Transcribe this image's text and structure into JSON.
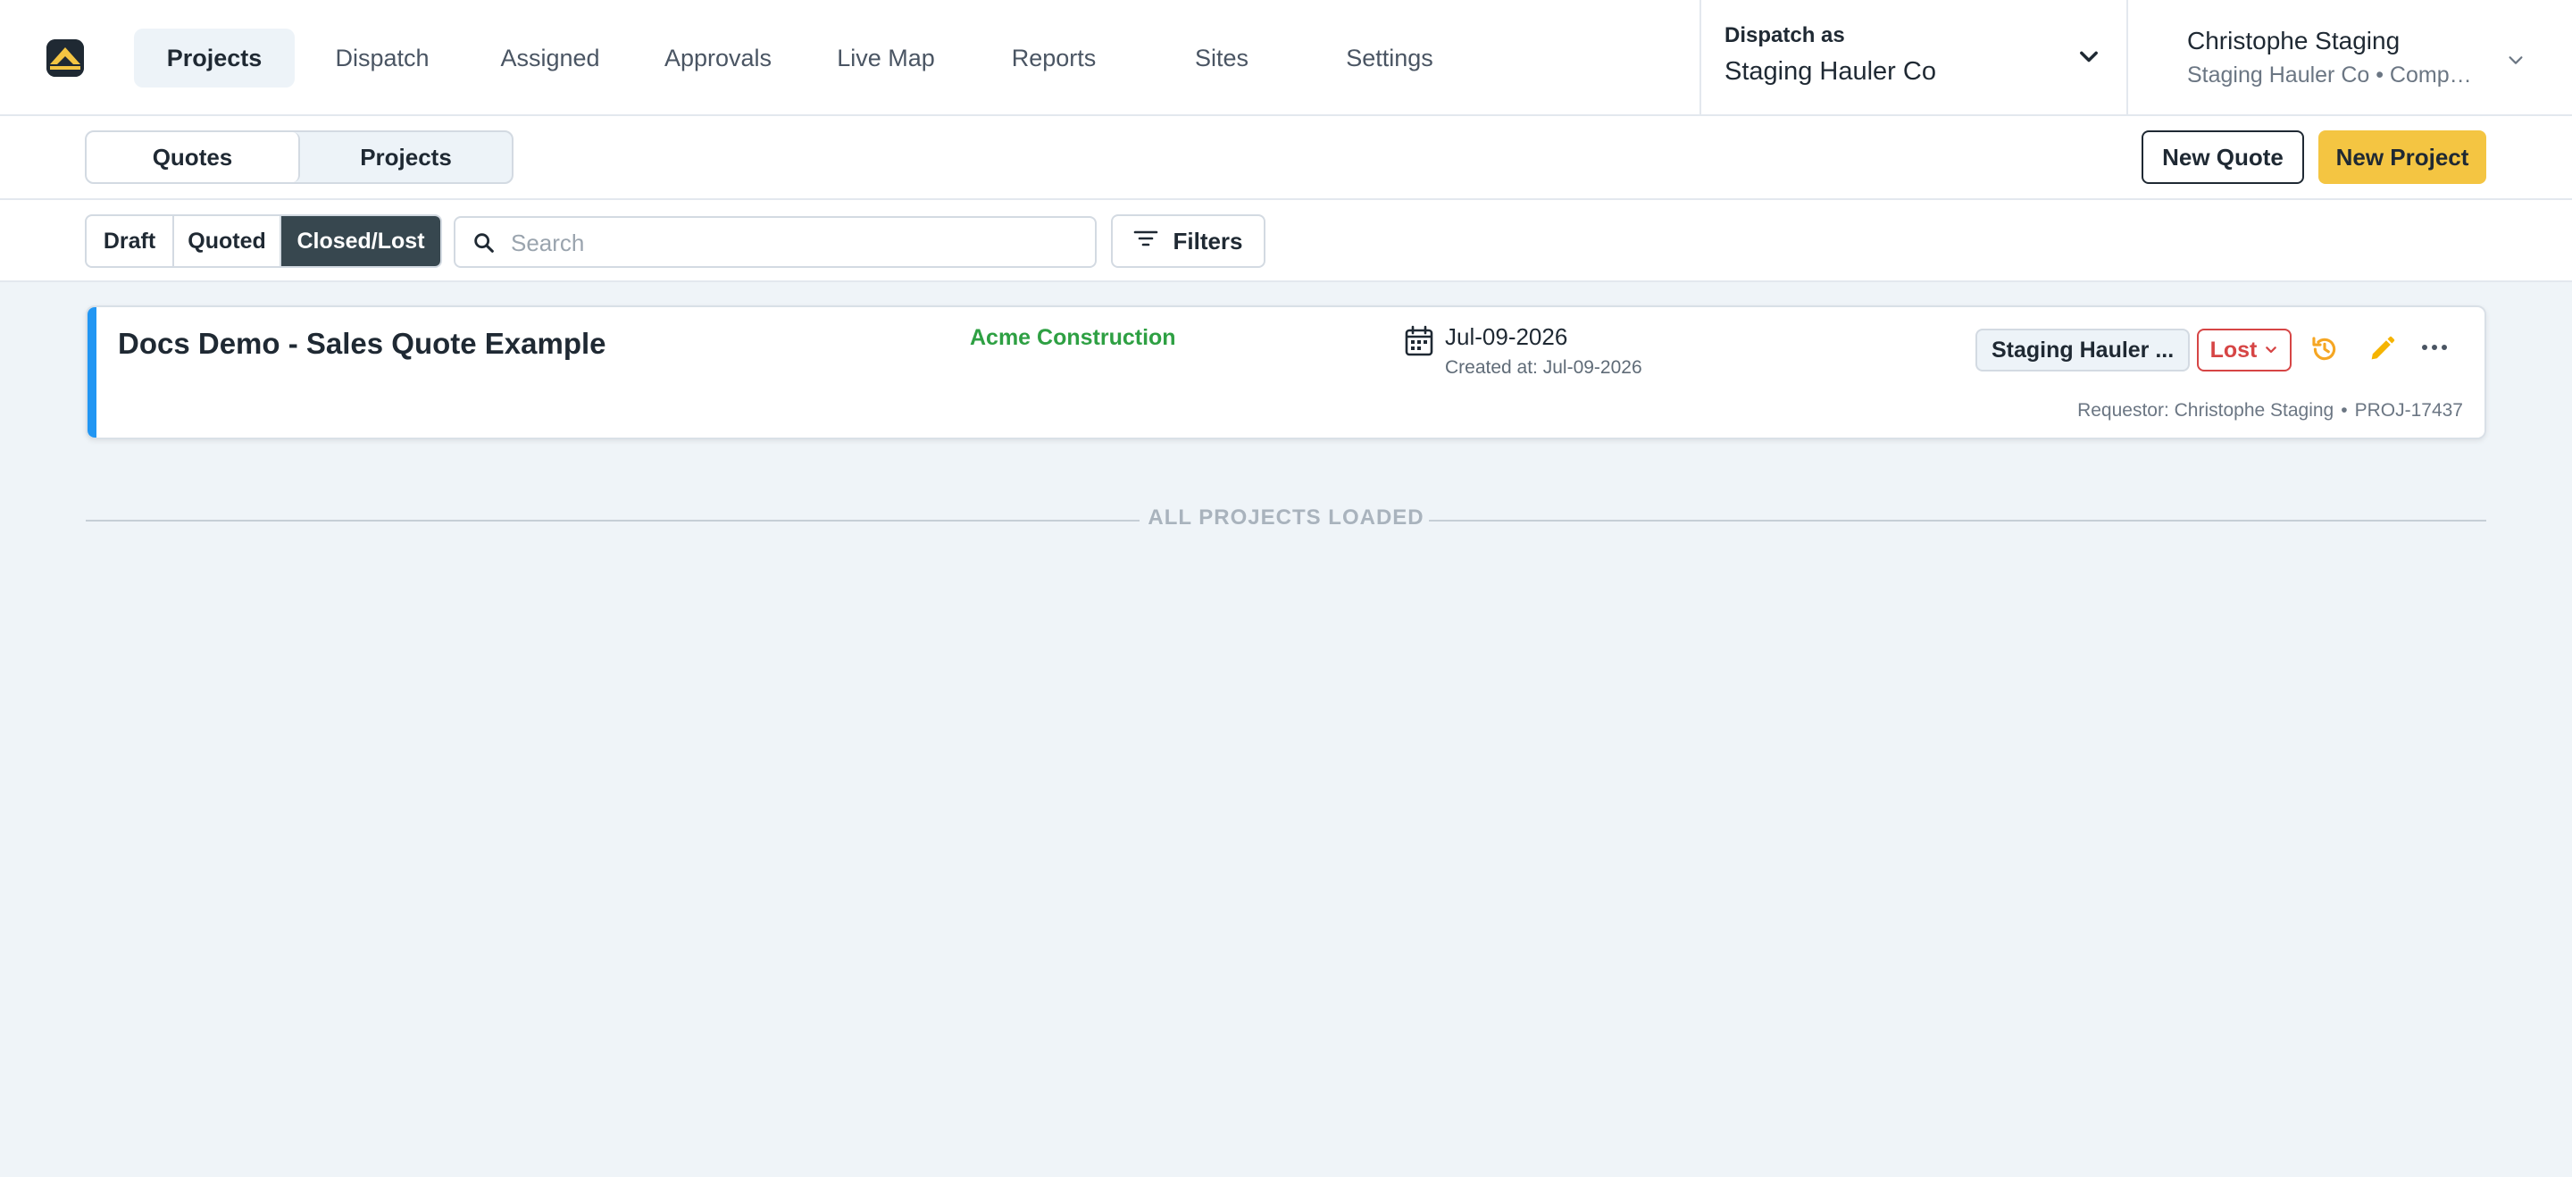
{
  "nav": {
    "items": [
      {
        "label": "Projects",
        "active": true
      },
      {
        "label": "Dispatch"
      },
      {
        "label": "Assigned"
      },
      {
        "label": "Approvals"
      },
      {
        "label": "Live Map"
      },
      {
        "label": "Reports"
      },
      {
        "label": "Sites"
      },
      {
        "label": "Settings"
      }
    ]
  },
  "dispatch": {
    "label": "Dispatch as",
    "value": "Staging Hauler Co"
  },
  "user": {
    "name": "Christophe Staging",
    "org": "Staging Hauler Co • Compa..."
  },
  "subheader": {
    "tabs": [
      {
        "label": "Quotes",
        "active": true
      },
      {
        "label": "Projects"
      }
    ],
    "new_quote": "New Quote",
    "new_project": "New Project"
  },
  "filters": {
    "statuses": [
      {
        "label": "Draft"
      },
      {
        "label": "Quoted"
      },
      {
        "label": "Closed/Lost",
        "active": true
      }
    ],
    "search_placeholder": "Search",
    "filters_label": "Filters"
  },
  "card": {
    "title": "Docs Demo - Sales Quote Example",
    "customer": "Acme Construction",
    "date": "Jul-09-2026",
    "created": "Created at: Jul-09-2026",
    "hauler": "Staging Hauler ...",
    "status": "Lost",
    "requestor": "Requestor: Christophe Staging",
    "dot": "•",
    "project_id": "PROJ-17437"
  },
  "footer": {
    "loaded_text": "ALL PROJECTS LOADED"
  },
  "colors": {
    "accent": "#2196f3",
    "brand_yellow": "#f4c542",
    "lost": "#d64545",
    "customer": "#2ea043",
    "history": "#f5a623"
  }
}
